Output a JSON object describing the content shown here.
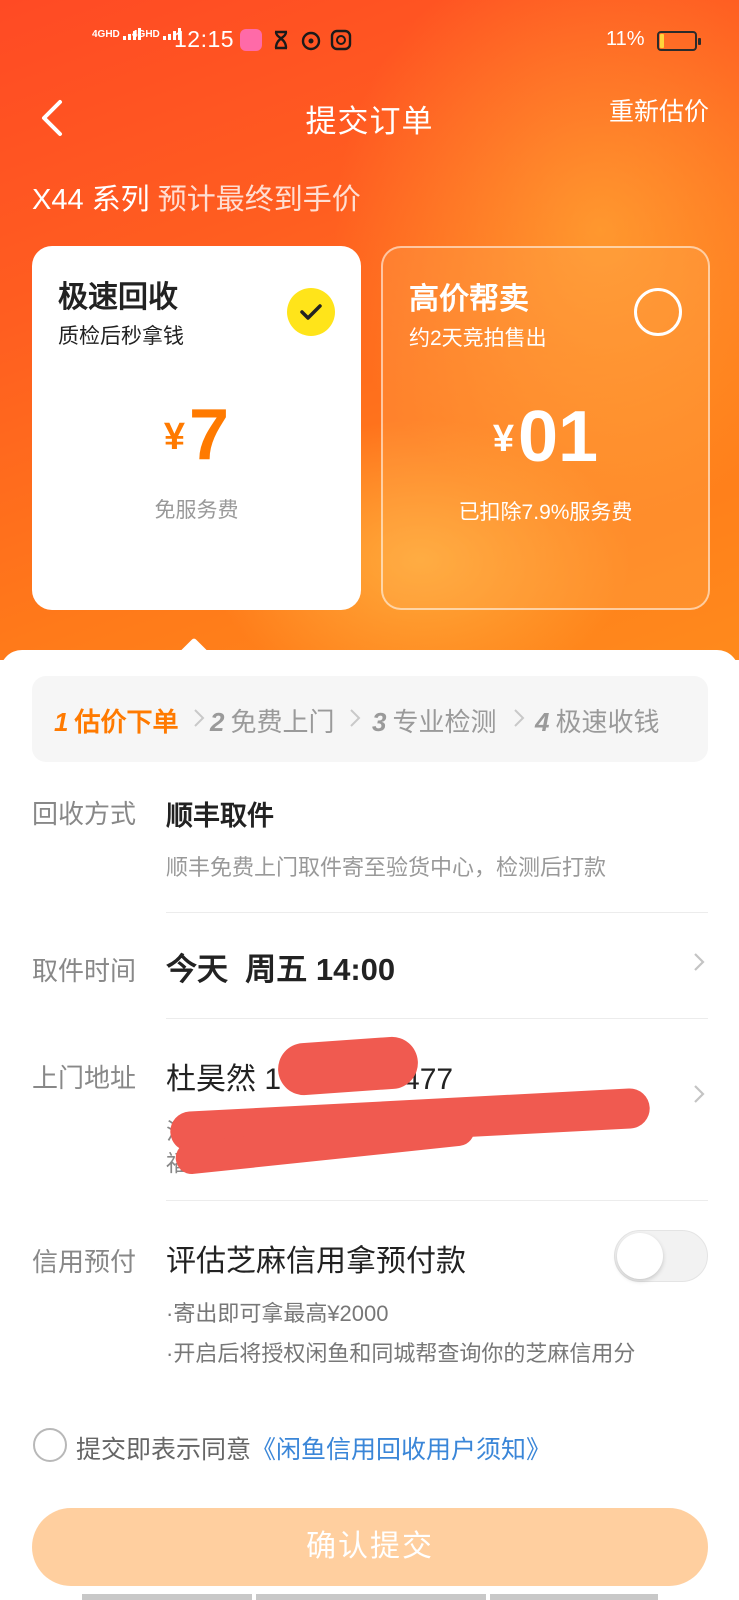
{
  "status_bar": {
    "sig1_label": "4GHD",
    "sig2_label": "4GHD",
    "time": "12:15",
    "battery": "11%",
    "battery_level": 0.11
  },
  "nav": {
    "title": "提交订单",
    "action": "重新估价"
  },
  "subtitle": {
    "model": "X44 系列",
    "caption": "预计最终到手价"
  },
  "options": [
    {
      "title": "极速回收",
      "desc": "质检后秒拿钱",
      "currency": "¥",
      "price": "7",
      "note": "免服务费",
      "selected": true
    },
    {
      "title": "高价帮卖",
      "desc": "约2天竞拍售出",
      "currency": "¥",
      "price": "01",
      "note": "已扣除7.9%服务费",
      "selected": false
    }
  ],
  "steps": [
    {
      "num": "1",
      "label": "估价下单",
      "active": true
    },
    {
      "num": "2",
      "label": "免费上门",
      "active": false
    },
    {
      "num": "3",
      "label": "专业检测",
      "active": false
    },
    {
      "num": "4",
      "label": "极速收钱",
      "active": false
    }
  ],
  "method": {
    "label": "回收方式",
    "value": "顺丰取件",
    "hint": "顺丰免费上门取件寄至验货中心，检测后打款"
  },
  "pickup": {
    "label": "取件时间",
    "value": "今天  周五 14:00"
  },
  "address": {
    "label": "上门地址",
    "name": "杜昊然",
    "phone_prefix": "1",
    "phone_suffix": "477",
    "line1_prefix": "江苏",
    "line2_prefix": "福"
  },
  "credit": {
    "label": "信用预付",
    "title": "评估芝麻信用拿预付款",
    "enabled": false,
    "bullets": [
      "·寄出即可拿最高¥2000",
      "·开启后将授权闲鱼和同城帮查询你的芝麻信用分"
    ]
  },
  "agreement": {
    "text": "提交即表示同意",
    "link": "《闲鱼信用回收用户须知》",
    "checked": false
  },
  "submit_label": "确认提交",
  "colors": {
    "brand_orange": "#ff7a00",
    "hero_start": "#ff4a24",
    "hero_end": "#ff8a1c",
    "check_yellow": "#ffe41a",
    "link_blue": "#3a86d8",
    "submit_disabled": "#ffcf9f"
  }
}
